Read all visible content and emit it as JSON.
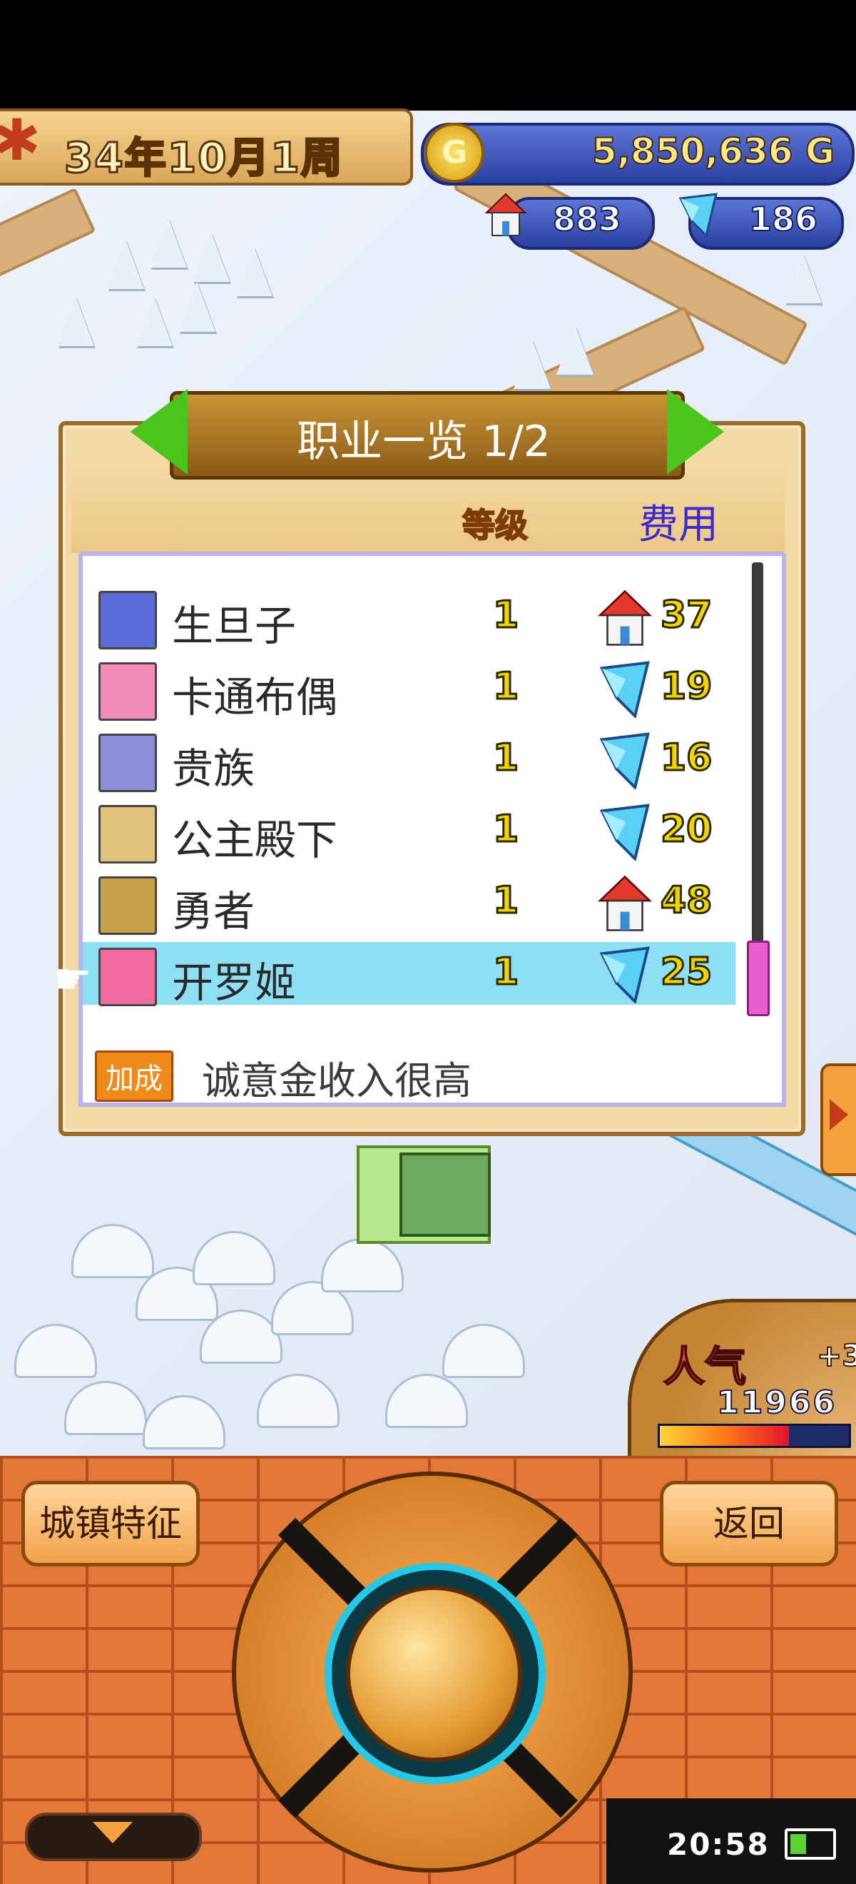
{
  "status_top": {},
  "date": {
    "text": "34年10月1周"
  },
  "resources": {
    "gold": "5,850,636 G",
    "gold_icon_letter": "G",
    "houses": "883",
    "crystals": "186"
  },
  "dialog": {
    "title": "职业一览 1/2",
    "col_level": "等级",
    "col_cost": "费用",
    "rows": [
      {
        "name": "生旦子",
        "level": "1",
        "cost_icon": "house-icon",
        "cost": "37",
        "avatar_color": "#5a6ad8"
      },
      {
        "name": "卡通布偶",
        "level": "1",
        "cost_icon": "crystal-icon",
        "cost": "19",
        "avatar_color": "#f28bb8"
      },
      {
        "name": "贵族",
        "level": "1",
        "cost_icon": "crystal-icon",
        "cost": "16",
        "avatar_color": "#8a8fd8"
      },
      {
        "name": "公主殿下",
        "level": "1",
        "cost_icon": "crystal-icon",
        "cost": "20",
        "avatar_color": "#e0c27a"
      },
      {
        "name": "勇者",
        "level": "1",
        "cost_icon": "house-icon",
        "cost": "48",
        "avatar_color": "#c9a04a"
      },
      {
        "name": "开罗姬",
        "level": "1",
        "cost_icon": "crystal-icon",
        "cost": "25",
        "avatar_color": "#f06aa0",
        "selected": true
      }
    ],
    "bonus_tag": "加成",
    "bonus_text": "诚意金收入很高"
  },
  "popularity": {
    "label": "人气",
    "bonus": "+3",
    "value": "11966",
    "bar_level": 0.7
  },
  "buttons": {
    "town_features": "城镇特征",
    "back": "返回"
  },
  "clock": "20:58",
  "colors": {
    "selected_row": "#8fdff4",
    "cost_text": "#f3d300",
    "cost_header": "#3a2ad0",
    "level_header": "#f4a028"
  }
}
